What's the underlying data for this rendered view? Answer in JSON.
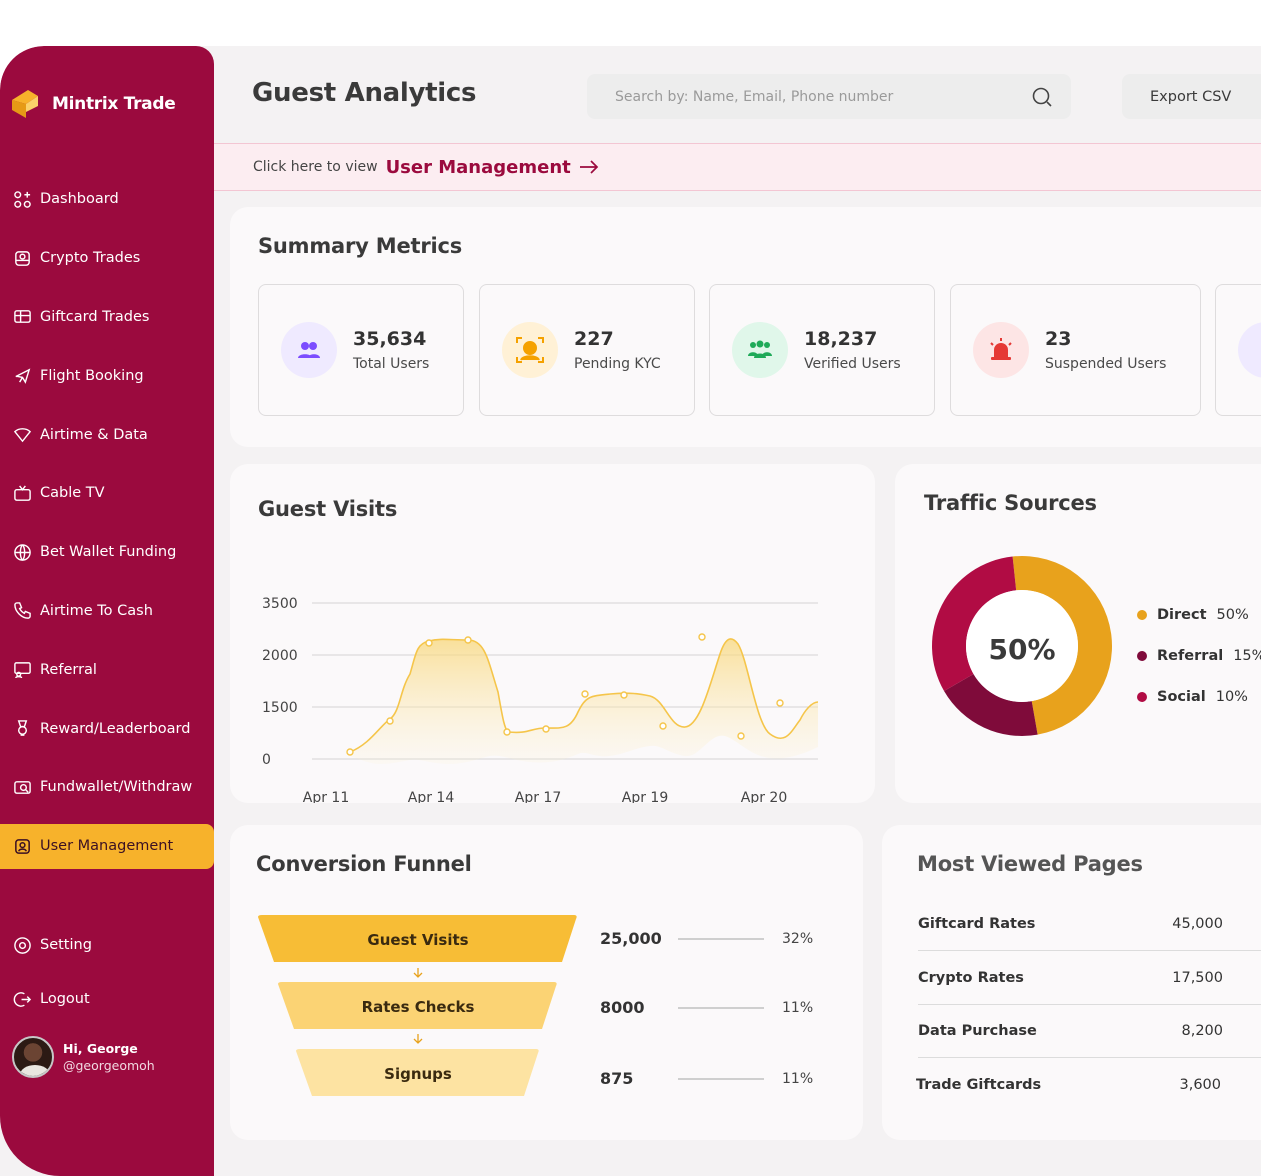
{
  "app": {
    "brand": "Mintrix Trade"
  },
  "sidebar": {
    "items": [
      {
        "label": "Dashboard",
        "icon": "dashboard-icon"
      },
      {
        "label": "Crypto Trades",
        "icon": "crypto-icon"
      },
      {
        "label": "Giftcard Trades",
        "icon": "giftcard-icon"
      },
      {
        "label": "Flight Booking",
        "icon": "plane-icon"
      },
      {
        "label": "Airtime & Data",
        "icon": "wifi-icon"
      },
      {
        "label": "Cable TV",
        "icon": "tv-icon"
      },
      {
        "label": "Bet Wallet Funding",
        "icon": "ball-icon"
      },
      {
        "label": "Airtime To Cash",
        "icon": "phone-icon"
      },
      {
        "label": "Referral",
        "icon": "referral-icon"
      },
      {
        "label": "Reward/Leaderboard",
        "icon": "trophy-icon"
      },
      {
        "label": "Fundwallet/Withdraw",
        "icon": "wallet-icon"
      },
      {
        "label": "User Management",
        "icon": "user-icon",
        "active": true
      }
    ],
    "bottom": [
      {
        "label": "Setting",
        "icon": "gear-icon"
      },
      {
        "label": "Logout",
        "icon": "logout-icon"
      }
    ],
    "user": {
      "greeting": "Hi, George",
      "handle": "@georgeomoh"
    }
  },
  "header": {
    "title": "Guest Analytics",
    "search_placeholder": "Search by: Name, Email, Phone number",
    "export_label": "Export CSV"
  },
  "banner": {
    "prefix": "Click here to view",
    "link": "User Management"
  },
  "summary": {
    "title": "Summary Metrics",
    "metrics": [
      {
        "value": "35,634",
        "label": "Total Users",
        "color": "#7c4dff",
        "bg": "#efeaff"
      },
      {
        "value": "227",
        "label": "Pending KYC",
        "color": "#f5a100",
        "bg": "#fff1d6"
      },
      {
        "value": "18,237",
        "label": "Verified Users",
        "color": "#1faa59",
        "bg": "#e0f7ea"
      },
      {
        "value": "23",
        "label": "Suspended Users",
        "color": "#e53935",
        "bg": "#fde5e5"
      }
    ]
  },
  "guest_visits": {
    "title": "Guest Visits",
    "chart_data": {
      "type": "area",
      "title": "Guest Visits",
      "y_ticks": [
        3500,
        2000,
        1500,
        0
      ],
      "x_ticks": [
        "Apr 11",
        "Apr 14",
        "Apr 17",
        "Apr 19",
        "Apr 20"
      ],
      "color": "#f5c54a"
    }
  },
  "traffic": {
    "title": "Traffic Sources",
    "center_label": "50%",
    "chart_data": {
      "type": "pie",
      "slices": [
        {
          "name": "Direct",
          "value": 50,
          "label": "50%",
          "color": "#e8a21c"
        },
        {
          "name": "Referral",
          "value": 15,
          "label": "15%",
          "color": "#7f0b3a"
        },
        {
          "name": "Social",
          "value": 10,
          "label": "10%",
          "color": "#b10c44"
        }
      ]
    }
  },
  "funnel": {
    "title": "Conversion Funnel",
    "steps": [
      {
        "label": "Guest Visits",
        "value": "25,000",
        "pct": "32%",
        "color": "#f7bd36"
      },
      {
        "label": "Rates Checks",
        "value": "8000",
        "pct": "11%",
        "color": "#fbd374"
      },
      {
        "label": "Signups",
        "value": "875",
        "pct": "11%",
        "color": "#fde3a2"
      }
    ]
  },
  "most_viewed": {
    "title": "Most Viewed Pages",
    "rows": [
      {
        "name": "Giftcard Rates",
        "value": "45,000"
      },
      {
        "name": "Crypto Rates",
        "value": "17,500"
      },
      {
        "name": "Data Purchase",
        "value": "8,200"
      },
      {
        "name": "Trade Giftcards",
        "value": "3,600"
      }
    ]
  }
}
